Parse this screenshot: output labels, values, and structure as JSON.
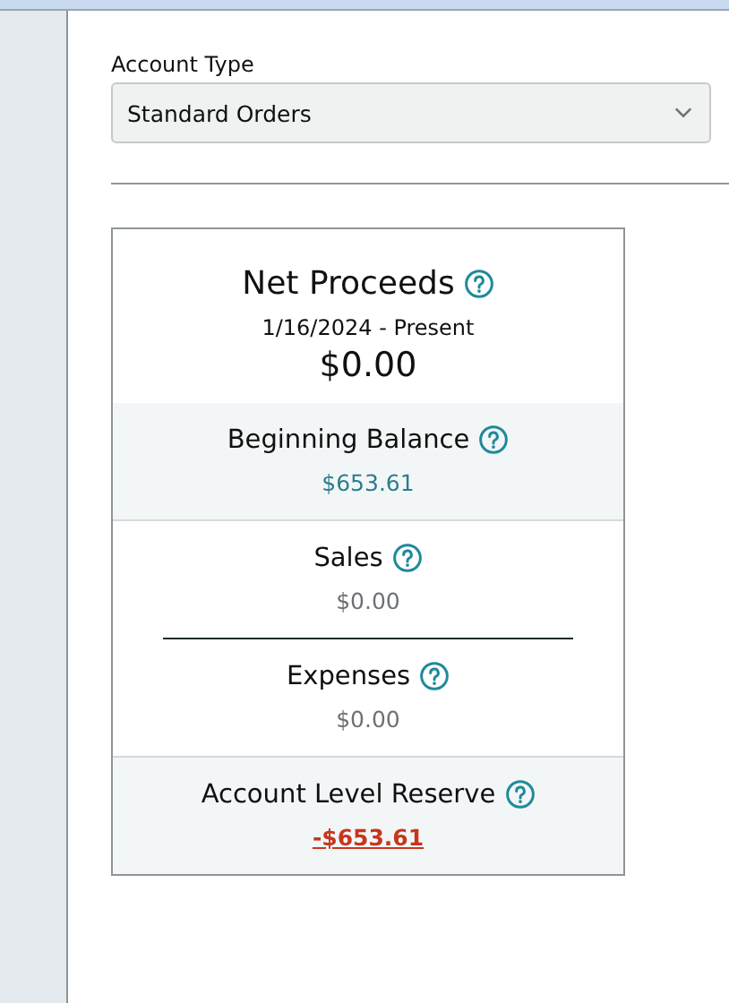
{
  "account_type": {
    "label": "Account Type",
    "value": "Standard Orders"
  },
  "summary": {
    "title": "Net Proceeds",
    "period": "1/16/2024 - Present",
    "total": "$0.00"
  },
  "rows": [
    {
      "kind": "balance",
      "label": "Beginning Balance",
      "value": "$653.61"
    },
    {
      "kind": "activity",
      "label": "Sales",
      "value": "$0.00"
    },
    {
      "kind": "activity",
      "label": "Expenses",
      "value": "$0.00"
    },
    {
      "kind": "reserve",
      "label": "Account Level Reserve",
      "value": "-$653.61"
    }
  ]
}
